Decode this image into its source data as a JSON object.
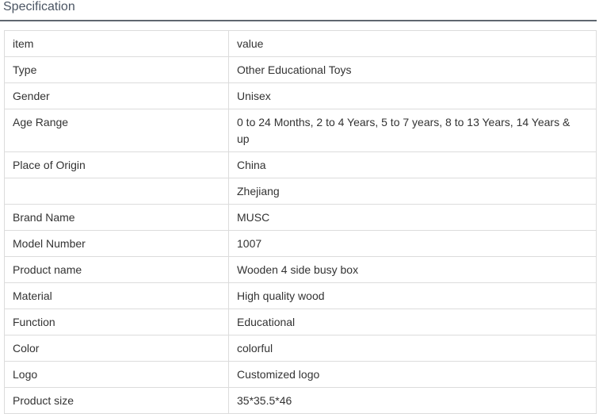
{
  "section": {
    "title": "Specification"
  },
  "table": {
    "header": {
      "item": "item",
      "value": "value"
    },
    "rows": [
      {
        "item": "Type",
        "value": "Other Educational Toys"
      },
      {
        "item": "Gender",
        "value": "Unisex"
      },
      {
        "item": "Age Range",
        "value": "0 to 24 Months, 2 to 4 Years, 5 to 7 years, 8 to 13 Years, 14 Years & up"
      },
      {
        "item": "Place of Origin",
        "value": "China"
      },
      {
        "item": "",
        "value": "Zhejiang"
      },
      {
        "item": "Brand Name",
        "value": "MUSC"
      },
      {
        "item": "Model Number",
        "value": "1007"
      },
      {
        "item": "Product name",
        "value": "Wooden 4 side busy box"
      },
      {
        "item": "Material",
        "value": "High quality wood"
      },
      {
        "item": "Function",
        "value": "Educational"
      },
      {
        "item": "Color",
        "value": "colorful"
      },
      {
        "item": "Logo",
        "value": "Customized logo"
      },
      {
        "item": "Product size",
        "value": "35*35.5*46"
      }
    ]
  }
}
